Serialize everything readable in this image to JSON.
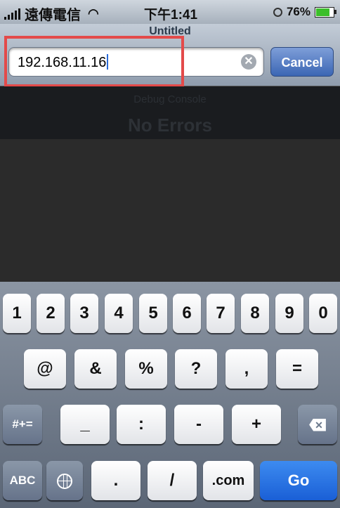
{
  "status_bar": {
    "carrier": "遠傳電信",
    "time": "下午1:41",
    "battery": "76%",
    "battery_level": 0.76
  },
  "url_bar": {
    "title": "Untitled",
    "url_value": "192.168.11.16",
    "cancel_label": "Cancel"
  },
  "console": {
    "subtitle": "Debug Console",
    "message": "No Errors"
  },
  "keyboard": {
    "row1": [
      "1",
      "2",
      "3",
      "4",
      "5",
      "6",
      "7",
      "8",
      "9",
      "0"
    ],
    "row2": [
      "@",
      "&",
      "%",
      "?",
      ",",
      "="
    ],
    "row3_mode": "#+=",
    "row3": [
      "_",
      ":",
      "-",
      "+"
    ],
    "row4_mode": "ABC",
    "row4": [
      ".",
      "/",
      ".com"
    ],
    "go_label": "Go"
  },
  "colors": {
    "highlight": "#e34a4a",
    "go_button": "#1a5fd6",
    "cancel_button": "#3b66b4"
  }
}
